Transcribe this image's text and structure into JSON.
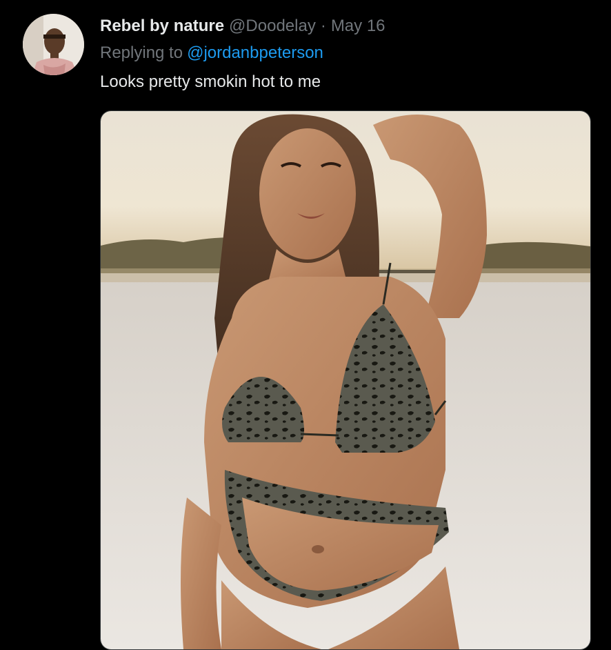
{
  "tweet": {
    "author": {
      "display_name": "Rebel by nature",
      "handle": "@Doodelay"
    },
    "separator": "·",
    "date": "May 16",
    "reply": {
      "prefix": "Replying to",
      "mention": "@jordanbpeterson"
    },
    "text": "Looks pretty smokin hot to me",
    "media": {
      "kind": "photo"
    }
  },
  "colors": {
    "background": "#000000",
    "primary_text": "#e7e9ea",
    "secondary_text": "#71767b",
    "link": "#1d9bf0"
  }
}
